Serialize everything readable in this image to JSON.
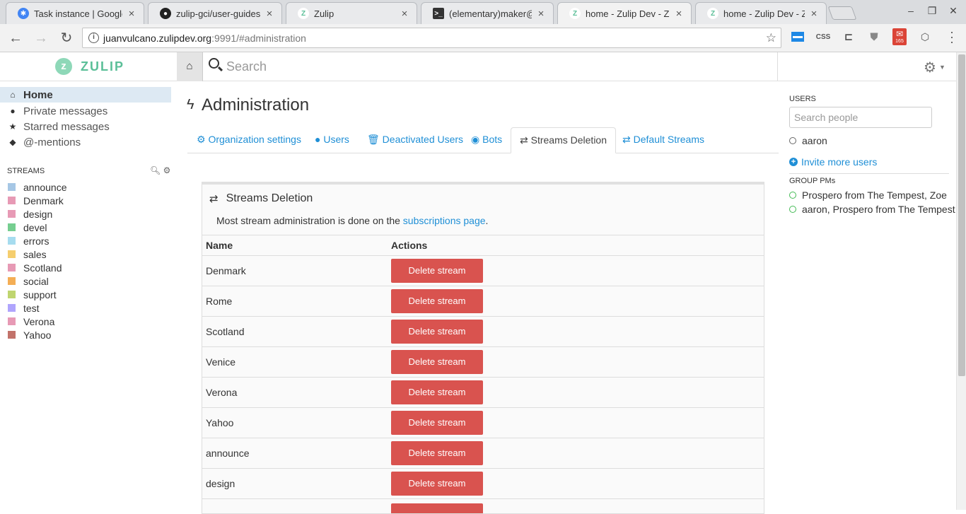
{
  "browser": {
    "tabs": [
      {
        "title": "Task instance | Google C",
        "favicon": "google-code-in-icon",
        "color": "#4285f4"
      },
      {
        "title": "zulip-gci/user-guides.m",
        "favicon": "github-icon",
        "color": "#222222"
      },
      {
        "title": "Zulip",
        "favicon": "zulip-icon",
        "color": "#5bbf98"
      },
      {
        "title": "(elementary)maker@loc",
        "favicon": "terminal-icon",
        "color": "#333333"
      },
      {
        "title": "home - Zulip Dev - Zulip",
        "favicon": "zulip-icon",
        "color": "#5bbf98"
      },
      {
        "title": "home - Zulip Dev - Zulip",
        "favicon": "zulip-icon",
        "color": "#5bbf98"
      }
    ],
    "url_host": "juanvulcano.zulipdev.org",
    "url_rest": ":9991/#administration",
    "badge_count": "165"
  },
  "app": {
    "logo_text": "ZULIP",
    "search_placeholder": "Search"
  },
  "left_nav": {
    "items": [
      "Home",
      "Private messages",
      "Starred messages",
      "@-mentions"
    ],
    "streams_header": "STREAMS",
    "streams": [
      {
        "name": "announce",
        "color": "#a6c7e5"
      },
      {
        "name": "Denmark",
        "color": "#e79ab5"
      },
      {
        "name": "design",
        "color": "#e79ab5"
      },
      {
        "name": "devel",
        "color": "#76ce90"
      },
      {
        "name": "errors",
        "color": "#a6dcef"
      },
      {
        "name": "sales",
        "color": "#f5ce6e"
      },
      {
        "name": "Scotland",
        "color": "#e79ab5"
      },
      {
        "name": "social",
        "color": "#f4ae55"
      },
      {
        "name": "support",
        "color": "#bfd56f"
      },
      {
        "name": "test",
        "color": "#b0a5fd"
      },
      {
        "name": "Verona",
        "color": "#e79ab5"
      },
      {
        "name": "Yahoo",
        "color": "#c2726a"
      }
    ]
  },
  "main": {
    "title": "Administration",
    "tabs": [
      "Organization settings",
      "Users",
      "Deactivated Users",
      "Bots",
      "Streams Deletion",
      "Default Streams"
    ],
    "active_tab": "Streams Deletion",
    "panel_title": "Streams Deletion",
    "note_prefix": "Most stream administration is done on the ",
    "note_link": "subscriptions page",
    "note_suffix": ".",
    "col_name": "Name",
    "col_actions": "Actions",
    "delete_label": "Delete stream",
    "rows": [
      "Denmark",
      "Rome",
      "Scotland",
      "Venice",
      "Verona",
      "Yahoo",
      "announce",
      "design"
    ]
  },
  "right_nav": {
    "users_header": "USERS",
    "search_placeholder": "Search people",
    "users": [
      "aaron"
    ],
    "invite_label": "Invite more users",
    "group_header": "GROUP PMs",
    "group_pms": [
      "Prospero from The Tempest, Zoe",
      "aaron, Prospero from The Tempest"
    ]
  }
}
